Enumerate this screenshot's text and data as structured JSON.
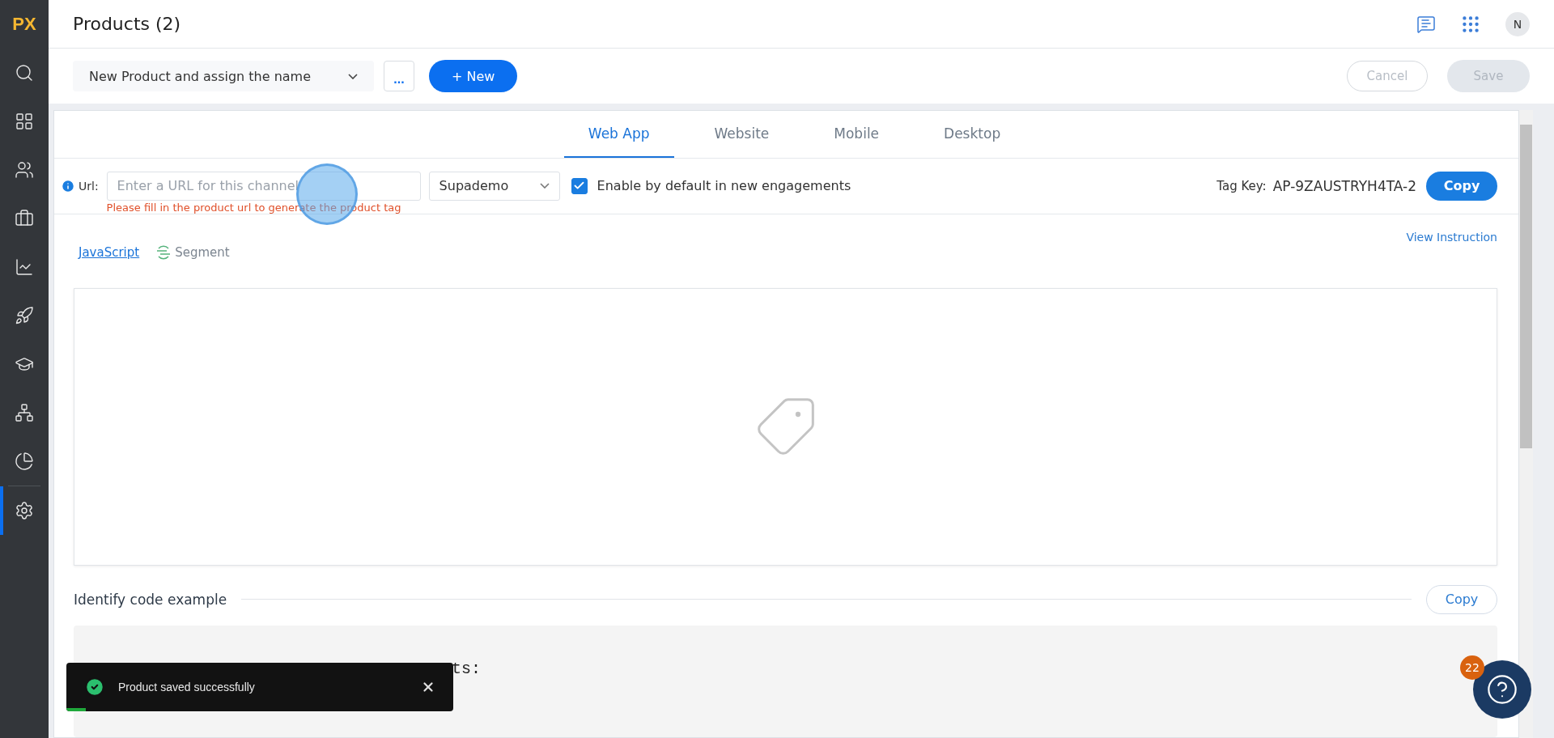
{
  "sidebar": {
    "logo": "PX",
    "items": [
      {
        "kind": "search",
        "selected": false
      },
      {
        "kind": "dashboard",
        "selected": false
      },
      {
        "kind": "users",
        "selected": false
      },
      {
        "kind": "briefcase",
        "selected": false
      },
      {
        "kind": "chart",
        "selected": false
      },
      {
        "kind": "rocket",
        "selected": false
      },
      {
        "kind": "learning",
        "selected": false
      },
      {
        "kind": "tree",
        "selected": false
      },
      {
        "kind": "pie",
        "selected": false
      },
      {
        "kind": "settings",
        "selected": true
      }
    ]
  },
  "header": {
    "title": "Products (2)",
    "avatar": "N"
  },
  "toolbar": {
    "product": "New Product and assign the name",
    "more": "...",
    "new_button": "+ New",
    "cancel": {
      "label": "Cancel",
      "disabled": true
    },
    "save": {
      "label": "Save",
      "disabled": true
    }
  },
  "tabs": [
    {
      "label": "Web App",
      "selected": true
    },
    {
      "label": "Website",
      "selected": false
    },
    {
      "label": "Mobile",
      "selected": false
    },
    {
      "label": "Desktop",
      "selected": false
    }
  ],
  "url_row": {
    "label": "Url:",
    "placeholder": "Enter a URL for this channel",
    "error": "Please fill in the product url to generate the product tag",
    "channel": "Supademo",
    "enable": {
      "label": "Enable by default in new engagements",
      "checked": true
    },
    "tag_key_label": "Tag Key:",
    "tag_key": "AP-9ZAUSTRYH4TA-2",
    "copy": "Copy"
  },
  "integrations": [
    {
      "label": "JavaScript",
      "selected": true
    },
    {
      "label": "Segment",
      "selected": false
    }
  ],
  "view_instruction": "View Instruction",
  "identify": {
    "title": "Identify code example",
    "copy": "Copy",
    "code_lines": [
      "ts:"
    ]
  },
  "toast": {
    "message": "Product saved successfully"
  },
  "help": {
    "badge": "22"
  }
}
